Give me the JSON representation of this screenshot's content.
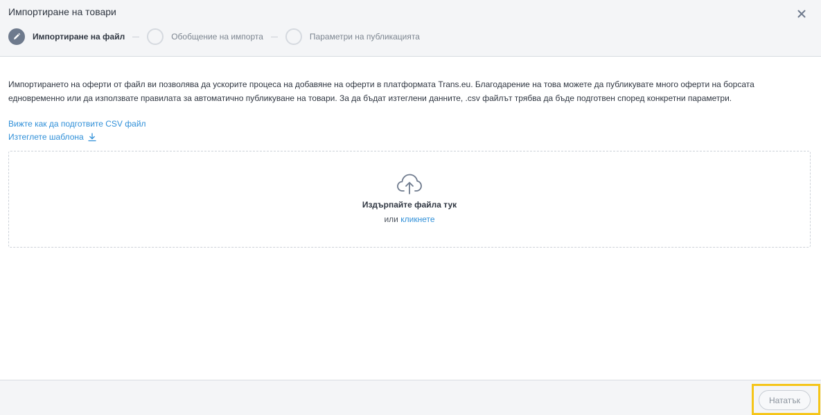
{
  "dialog": {
    "title": "Импортиране на товари"
  },
  "steps": [
    {
      "label": "Импортиране на файл",
      "state": "active",
      "icon": "pencil-icon"
    },
    {
      "label": "Обобщение на импорта",
      "state": "pending"
    },
    {
      "label": "Параметри на публикацията",
      "state": "pending"
    }
  ],
  "content": {
    "description": "Импортирането на оферти от файл ви позволява да ускорите процеса на добавяне на оферти в платформата Trans.eu. Благодарение на това можете да публикувате много оферти на борсата едновременно или да използвате правилата за автоматично публикуване на товари. За да бъдат изтеглени данните, .csv файлът трябва да бъде подготвен според конкретни параметри.",
    "link_csv_guide": "Вижте как да подготвите CSV файл",
    "link_download_template": "Изтеглете шаблона"
  },
  "dropzone": {
    "icon": "cloud-upload-icon",
    "title": "Издърпайте файла тук",
    "or_text": "или",
    "click_text": "кликнете"
  },
  "footer": {
    "next_label": "Нататък",
    "next_disabled": true
  },
  "colors": {
    "accent_link": "#2f8fd8",
    "active_step": "#6e7a8d",
    "header_bg": "#f4f5f7",
    "highlight": "#f5c518"
  }
}
